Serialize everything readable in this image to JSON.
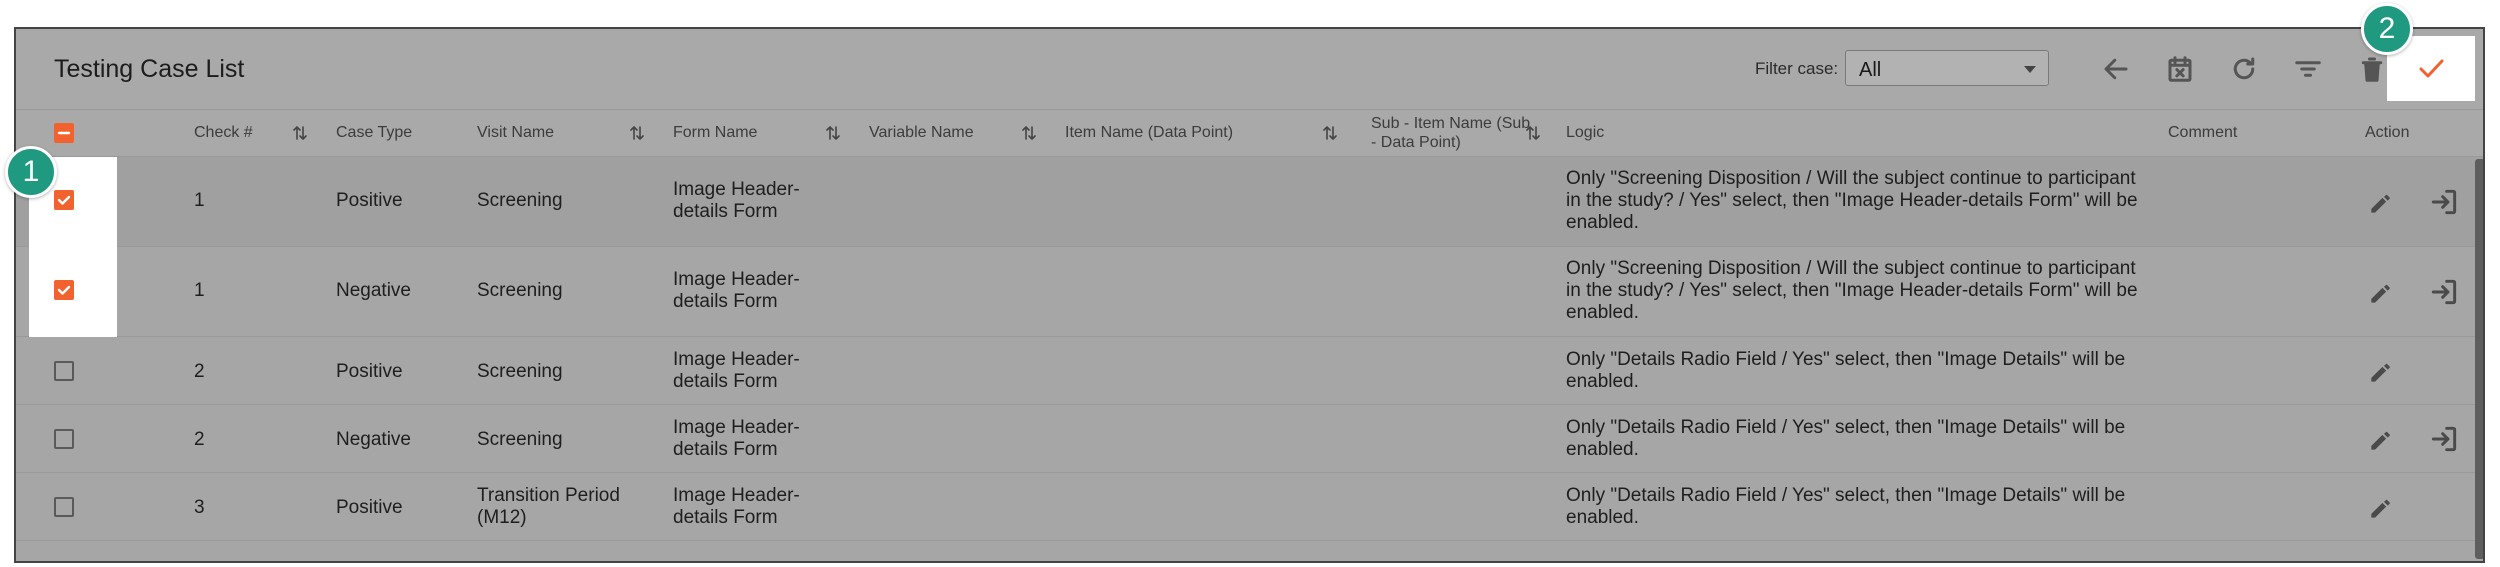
{
  "header": {
    "title": "Testing Case List",
    "filter_label": "Filter case:",
    "filter_value": "All"
  },
  "toolbar": {
    "icons": [
      "back-arrow-icon",
      "calendar-cancel-icon",
      "refresh-icon",
      "filter-icon",
      "delete-icon",
      "confirm-check-icon"
    ]
  },
  "columns": {
    "check": "Check #",
    "case_type": "Case Type",
    "visit_name": "Visit Name",
    "form_name": "Form Name",
    "variable_name": "Variable Name",
    "item_name": "Item Name (Data Point)",
    "sub_item_line1": "Sub - Item Name (Sub",
    "sub_item_line2": "- Data Point)",
    "logic": "Logic",
    "comment": "Comment",
    "action": "Action"
  },
  "rows": [
    {
      "checked": true,
      "check": "1",
      "case_type": "Positive",
      "visit_l1": "Screening",
      "visit_l2": "",
      "form_l1": "Image Header-",
      "form_l2": "details Form",
      "logic_l1": "Only \"Screening Disposition / Will the subject continue to participant",
      "logic_l2": "in the study? / Yes\" select, then \"Image Header-details Form\" will be",
      "logic_l3": "enabled."
    },
    {
      "checked": true,
      "check": "1",
      "case_type": "Negative",
      "visit_l1": "Screening",
      "visit_l2": "",
      "form_l1": "Image Header-",
      "form_l2": "details Form",
      "logic_l1": "Only \"Screening Disposition / Will the subject continue to participant",
      "logic_l2": "in the study? / Yes\" select, then \"Image Header-details Form\" will be",
      "logic_l3": "enabled."
    },
    {
      "checked": false,
      "check": "2",
      "case_type": "Positive",
      "visit_l1": "Screening",
      "visit_l2": "",
      "form_l1": "Image Header-",
      "form_l2": "details Form",
      "logic_l1": "Only \"Details Radio Field / Yes\" select, then \"Image Details\" will be",
      "logic_l2": "enabled.",
      "logic_l3": ""
    },
    {
      "checked": false,
      "check": "2",
      "case_type": "Negative",
      "visit_l1": "Screening",
      "visit_l2": "",
      "form_l1": "Image Header-",
      "form_l2": "details Form",
      "logic_l1": "Only \"Details Radio Field / Yes\" select, then \"Image Details\" will be",
      "logic_l2": "enabled.",
      "logic_l3": ""
    },
    {
      "checked": false,
      "check": "3",
      "case_type": "Positive",
      "visit_l1": "Transition Period",
      "visit_l2": "(M12)",
      "form_l1": "Image Header-",
      "form_l2": "details Form",
      "logic_l1": "Only \"Details Radio Field / Yes\" select, then \"Image Details\" will be",
      "logic_l2": "enabled.",
      "logic_l3": ""
    }
  ],
  "badges": {
    "one": "1",
    "two": "2"
  },
  "colors": {
    "accent": "#f2622e",
    "badge": "#1f9a80",
    "overlay_gray": "#a6a6a6"
  }
}
